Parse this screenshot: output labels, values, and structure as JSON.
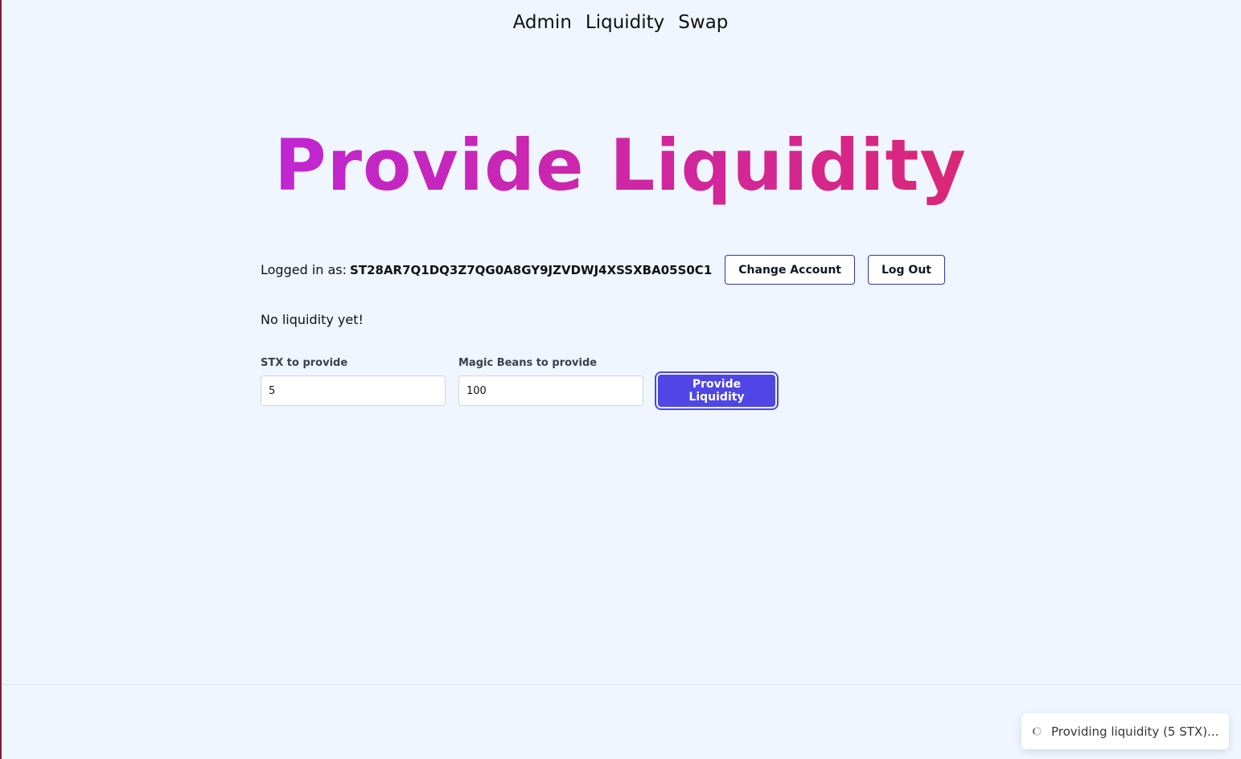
{
  "nav": {
    "items": [
      {
        "label": "Admin"
      },
      {
        "label": "Liquidity"
      },
      {
        "label": "Swap"
      }
    ]
  },
  "hero": {
    "title": "Provide Liquidity",
    "gradient_from": "#c026d3",
    "gradient_to": "#db2777"
  },
  "account": {
    "prefix": "Logged in as:",
    "address": "ST28AR7Q1DQ3Z7QG0A8GY9JZVDWJ4XSSXBA05S0C1",
    "change_label": "Change Account",
    "logout_label": "Log Out"
  },
  "status": {
    "text": "No liquidity yet!"
  },
  "form": {
    "stx_label": "STX to provide",
    "stx_value": "5",
    "beans_label": "Magic Beans to provide",
    "beans_value": "100",
    "submit_label": "Provide Liquidity",
    "accent": "#4f46e5"
  },
  "toast": {
    "icon": "spinner-icon",
    "text": "Providing liquidity (5 STX)..."
  }
}
